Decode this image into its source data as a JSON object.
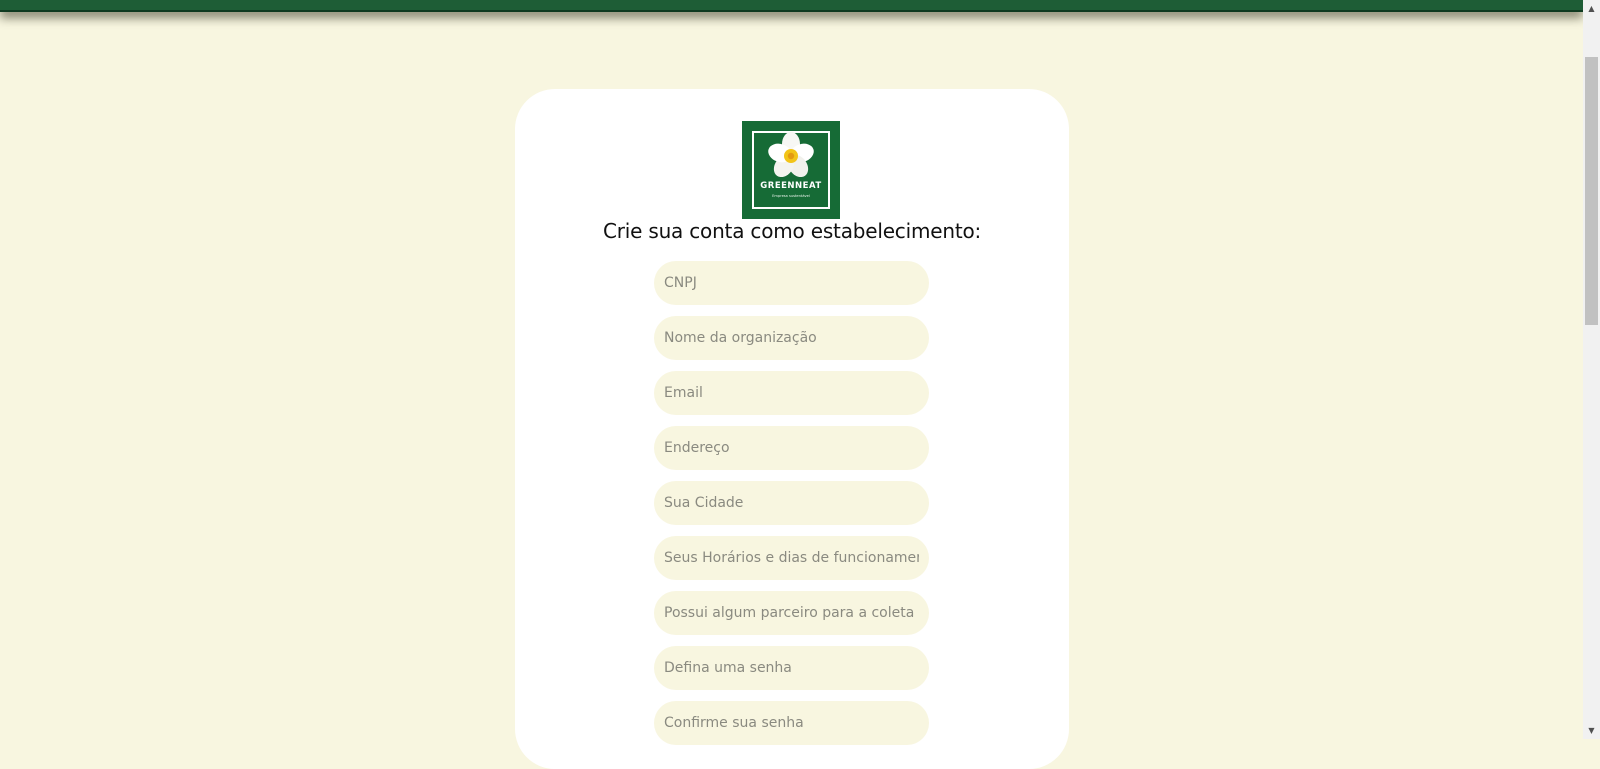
{
  "brand": {
    "name": "GREENNEAT",
    "tagline": "Empresa sustentável"
  },
  "form": {
    "title": "Crie sua conta como estabelecimento:",
    "fields": [
      {
        "placeholder": "CNPJ",
        "value": ""
      },
      {
        "placeholder": "Nome da organização",
        "value": ""
      },
      {
        "placeholder": "Email",
        "value": ""
      },
      {
        "placeholder": "Endereço",
        "value": ""
      },
      {
        "placeholder": "Sua Cidade",
        "value": ""
      },
      {
        "placeholder": "Seus Horários e dias de funcionamento",
        "value": ""
      },
      {
        "placeholder": "Possui algum parceiro para a coleta n",
        "value": ""
      },
      {
        "placeholder": "Defina uma senha",
        "value": ""
      },
      {
        "placeholder": "Confirme sua senha",
        "value": ""
      }
    ]
  },
  "colors": {
    "page_background": "#f8f6e0",
    "header_green": "#1e5d36",
    "logo_green": "#166b36",
    "card_background": "#ffffff",
    "input_background": "#f8f6e0"
  },
  "icons": {
    "scroll_up": "▲",
    "scroll_down": "▼"
  }
}
